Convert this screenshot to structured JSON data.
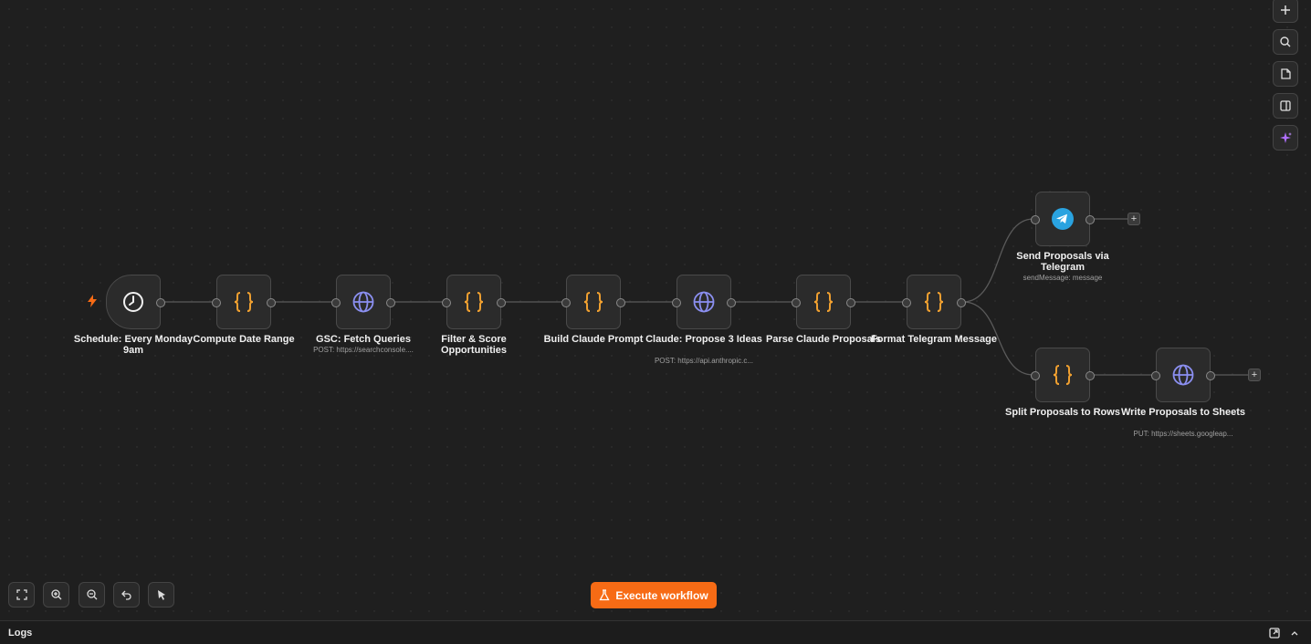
{
  "canvas": {
    "nodes": [
      {
        "id": "schedule",
        "title": "Schedule: Every Monday 9am",
        "subtitle": "",
        "icon": "clock-icon"
      },
      {
        "id": "compute-date",
        "title": "Compute Date Range",
        "subtitle": "",
        "icon": "code-braces-icon"
      },
      {
        "id": "gsc-fetch",
        "title": "GSC: Fetch Queries",
        "subtitle": "POST: https://searchconsole....",
        "icon": "globe-icon"
      },
      {
        "id": "filter-score",
        "title": "Filter & Score Opportunities",
        "subtitle": "",
        "icon": "code-braces-icon"
      },
      {
        "id": "build-prompt",
        "title": "Build Claude Prompt",
        "subtitle": "",
        "icon": "code-braces-icon"
      },
      {
        "id": "claude-propose",
        "title": "Claude: Propose 3 Ideas",
        "subtitle": "POST: https://api.anthropic.c...",
        "icon": "globe-icon"
      },
      {
        "id": "parse-proposals",
        "title": "Parse Claude Proposals",
        "subtitle": "",
        "icon": "code-braces-icon"
      },
      {
        "id": "format-telegram",
        "title": "Format Telegram Message",
        "subtitle": "",
        "icon": "code-braces-icon"
      },
      {
        "id": "send-telegram",
        "title": "Send Proposals via Telegram",
        "subtitle": "sendMessage: message",
        "icon": "telegram-icon"
      },
      {
        "id": "split-rows",
        "title": "Split Proposals to Rows",
        "subtitle": "",
        "icon": "code-braces-icon"
      },
      {
        "id": "write-sheets",
        "title": "Write Proposals to Sheets",
        "subtitle": "PUT: https://sheets.googleap...",
        "icon": "globe-icon"
      }
    ],
    "add_label": "+"
  },
  "toolbar_right": [
    "plus-icon",
    "search-icon",
    "sticky-note-icon",
    "panel-icon",
    "ai-sparkle-icon"
  ],
  "toolbar_bottom": [
    "fit-view-icon",
    "zoom-in-icon",
    "zoom-out-icon",
    "undo-icon",
    "tidy-up-icon"
  ],
  "execute": {
    "label": "Execute workflow"
  },
  "logs": {
    "label": "Logs"
  },
  "colors": {
    "accent": "#f76b15",
    "code": "#f0a030",
    "globe": "#8b8ff0",
    "telegram": "#2aa3e0"
  }
}
